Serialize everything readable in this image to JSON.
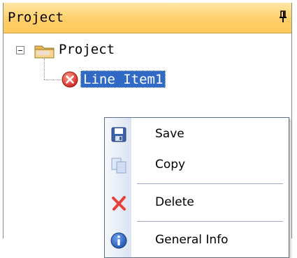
{
  "panel": {
    "title": "Project"
  },
  "tree": {
    "root": {
      "label": "Project",
      "expanded": true
    },
    "children": [
      {
        "label": "Line Item1",
        "selected": true,
        "status_icon": "error-icon"
      }
    ]
  },
  "context_menu": {
    "items": [
      {
        "label": "Save",
        "icon": "save-icon"
      },
      {
        "label": "Copy",
        "icon": "copy-icon"
      },
      {
        "label": "Delete",
        "icon": "delete-icon"
      },
      {
        "label": "General Info",
        "icon": "info-icon"
      }
    ]
  },
  "colors": {
    "header": "#ffcf6a",
    "selection": "#316ac5",
    "error": "#e5423a",
    "info": "#1e63c4"
  }
}
